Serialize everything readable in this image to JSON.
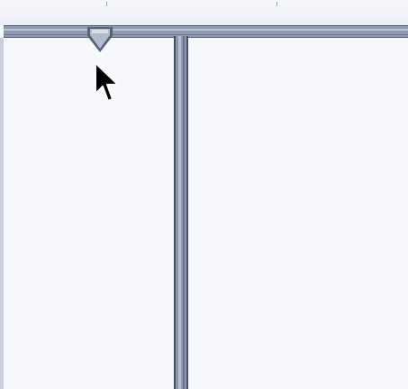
{
  "window": {
    "title": ""
  },
  "ruler": {
    "tick_count": 2
  },
  "tab_stop": {
    "icon": "tab-stop-marker-icon"
  },
  "cursor": {
    "icon": "arrow-cursor-icon"
  },
  "colors": {
    "splitter": "#8b97ad",
    "splitter_dark": "#44506a",
    "panel_background": "#f7f8fc"
  }
}
